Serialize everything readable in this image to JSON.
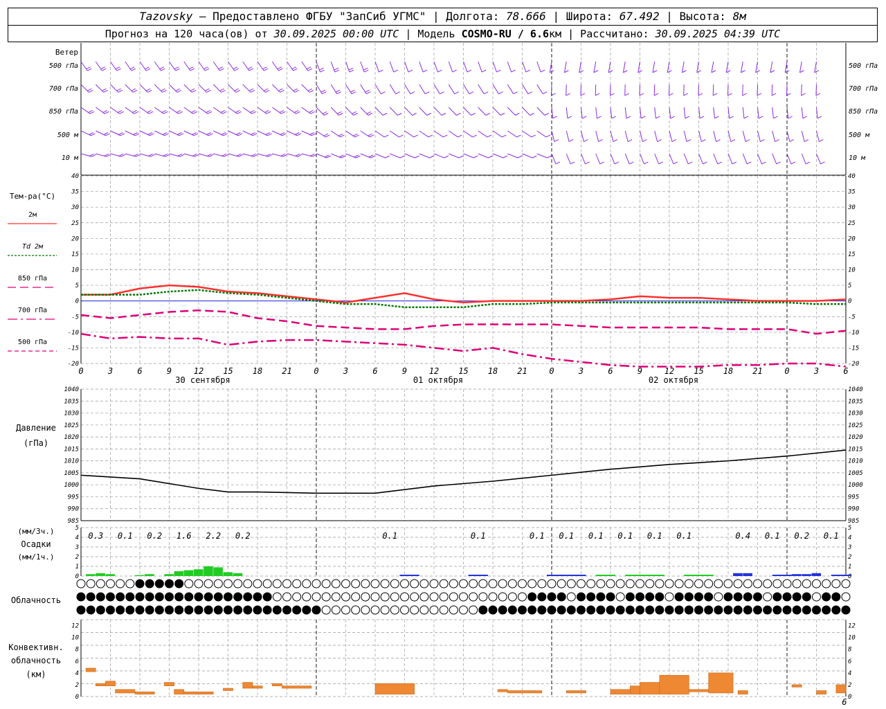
{
  "header": {
    "station": "Tazovsky",
    "provider": "— Предоставлено ФГБУ \"ЗапСиб УГМС\" |",
    "lon_label": "Долгота:",
    "lon": "78.666",
    "lat_label": "| Широта:",
    "lat": "67.492",
    "alt_label": "| Высота:",
    "alt": "8м",
    "forecast_label": "Прогноз на 120 часа(ов) от",
    "forecast_from": "30.09.2025 00:00 UTC",
    "model_label": "| Модель",
    "model": "COSMO-RU / 6.6",
    "model_unit": "км",
    "calc_label": "| Рассчитано:",
    "calc_time": "30.09.2025 04:39 UTC"
  },
  "time_axis": {
    "hour_ticks": [
      "0",
      "3",
      "6",
      "9",
      "12",
      "15",
      "18",
      "21",
      "0",
      "3",
      "6",
      "9",
      "12",
      "15",
      "18",
      "21",
      "0",
      "3",
      "6",
      "9",
      "12",
      "15",
      "18",
      "21",
      "0",
      "3",
      "6"
    ],
    "dates": [
      "30 сентября",
      "01 октября",
      "02 октября"
    ]
  },
  "wind_panel": {
    "labels": [
      "Ветер",
      "500 гПа",
      "700 гПа",
      "850 гПа",
      "500 м",
      "10  м"
    ],
    "right_labels": [
      "500 гПа",
      "700 гПа",
      "850 гПа",
      "500 м",
      "10  м"
    ],
    "color": "#8a2be2"
  },
  "cloud_panel": {
    "label": "Облачность"
  },
  "chart_data": [
    {
      "type": "line",
      "name": "temperature",
      "ylabel": "Тем-ра(°C)",
      "ylim": [
        -20,
        40
      ],
      "yticks": [
        "40",
        "35",
        "30",
        "25",
        "20",
        "15",
        "10",
        "5",
        "0",
        "-5",
        "-10",
        "-15",
        "-20"
      ],
      "x_hours": [
        0,
        3,
        6,
        9,
        12,
        15,
        18,
        21,
        24,
        27,
        30,
        33,
        36,
        39,
        42,
        45,
        48,
        51,
        54,
        57,
        60,
        63,
        66,
        69,
        72,
        75,
        78
      ],
      "series": [
        {
          "name": "2м",
          "color": "#ff3030",
          "style": "solid",
          "values": [
            2,
            2,
            4,
            5,
            4.5,
            3,
            2.5,
            1.5,
            0.5,
            -0.5,
            1,
            2.5,
            0.5,
            -0.5,
            0,
            0,
            0,
            0,
            0.5,
            1.5,
            1,
            1,
            0.5,
            0,
            0,
            0,
            0.5
          ]
        },
        {
          "name": "Td  2м",
          "color": "#007700",
          "style": "dotted",
          "values": [
            2,
            2,
            2,
            3,
            3.5,
            2.5,
            2,
            1,
            0,
            -1,
            -1,
            -2,
            -2,
            -2,
            -1,
            -1,
            -0.5,
            -0.5,
            -0.5,
            -0.5,
            -0.5,
            -0.5,
            -0.5,
            -0.5,
            -0.5,
            -1,
            -1
          ]
        },
        {
          "name": "850 гПа",
          "color": "#dd0077",
          "style": "dashed",
          "values": [
            -4.5,
            -5.5,
            -4.5,
            -3.5,
            -3,
            -3.5,
            -5.5,
            -6.5,
            -8,
            -8.5,
            -9,
            -9,
            -8,
            -7.5,
            -7.5,
            -7.5,
            -7.5,
            -8,
            -8.5,
            -8.5,
            -8.5,
            -8.5,
            -9,
            -9,
            -9,
            -10.5,
            -9.5
          ]
        },
        {
          "name": "700 гПа",
          "color": "#dd0077",
          "style": "dashdot",
          "values": [
            -10.5,
            -12,
            -11.5,
            -12,
            -12,
            -14,
            -13,
            -12.5,
            -12.5,
            -13,
            -13.5,
            -14,
            -15,
            -16,
            -15,
            -17,
            -18.5,
            -19.5,
            -20.5,
            -21,
            -21,
            -21,
            -20.5,
            -20.5,
            -20,
            -20,
            -21
          ]
        },
        {
          "name": "500 гПа",
          "color": "#dd0077",
          "style": "dash",
          "values": []
        }
      ],
      "baseline": 0
    },
    {
      "type": "line",
      "name": "pressure",
      "ylabel": "Давление",
      "unit": "(гПа)",
      "ylim": [
        985,
        1040
      ],
      "yticks": [
        "1040",
        "1035",
        "1030",
        "1025",
        "1020",
        "1015",
        "1010",
        "1005",
        "1000",
        "995",
        "990",
        "985"
      ],
      "x_hours": [
        0,
        6,
        12,
        15,
        18,
        24,
        30,
        36,
        42,
        48,
        54,
        60,
        66,
        72,
        78
      ],
      "values": [
        1004,
        1002.5,
        998.5,
        997,
        997,
        996.5,
        996.5,
        999.5,
        1001.5,
        1004,
        1006.5,
        1008.5,
        1010,
        1012,
        1014.5
      ]
    },
    {
      "type": "bar",
      "name": "precipitation",
      "ylabel": "Осадки",
      "unit3": "(мм/3ч.)",
      "unit1": "(мм/1ч.)",
      "ylim": [
        0,
        5
      ],
      "yticks": [
        "5",
        "4",
        "3",
        "2",
        "1",
        "0"
      ],
      "totals_3h": [
        {
          "hour": 1.5,
          "value": "0.3"
        },
        {
          "hour": 4.5,
          "value": "0.1"
        },
        {
          "hour": 7.5,
          "value": "0.2"
        },
        {
          "hour": 10.5,
          "value": "1.6"
        },
        {
          "hour": 13.5,
          "value": "2.2"
        },
        {
          "hour": 16.5,
          "value": "0.2"
        },
        {
          "hour": 31.5,
          "value": "0.1"
        },
        {
          "hour": 40.5,
          "value": "0.1"
        },
        {
          "hour": 46.5,
          "value": "0.1"
        },
        {
          "hour": 49.5,
          "value": "0.1"
        },
        {
          "hour": 52.5,
          "value": "0.1"
        },
        {
          "hour": 55.5,
          "value": "0.1"
        },
        {
          "hour": 58.5,
          "value": "0.1"
        },
        {
          "hour": 61.5,
          "value": "0.1"
        },
        {
          "hour": 67.5,
          "value": "0.4"
        },
        {
          "hour": 70.5,
          "value": "0.1"
        },
        {
          "hour": 73.5,
          "value": "0.2"
        },
        {
          "hour": 76.5,
          "value": "0.1"
        }
      ],
      "hourly_rain": [
        {
          "hour": 1,
          "value": 0.2
        },
        {
          "hour": 2,
          "value": 0.3
        },
        {
          "hour": 3,
          "value": 0.2
        },
        {
          "hour": 6,
          "value": 0.1
        },
        {
          "hour": 7,
          "value": 0.2
        },
        {
          "hour": 9,
          "value": 0.2
        },
        {
          "hour": 10,
          "value": 0.5
        },
        {
          "hour": 11,
          "value": 0.6
        },
        {
          "hour": 12,
          "value": 0.7
        },
        {
          "hour": 13,
          "value": 1.0
        },
        {
          "hour": 14,
          "value": 0.9
        },
        {
          "hour": 15,
          "value": 0.4
        },
        {
          "hour": 16,
          "value": 0.3
        }
      ],
      "hourly_snow": [
        {
          "hour": 67,
          "value": 0.3
        },
        {
          "hour": 68,
          "value": 0.3
        },
        {
          "hour": 73,
          "value": 0.2
        },
        {
          "hour": 74,
          "value": 0.2
        },
        {
          "hour": 75,
          "value": 0.3
        }
      ],
      "rain_color": "#22cc22",
      "snow_color": "#2233dd"
    },
    {
      "type": "bar",
      "name": "convective_clouds",
      "ylabel": "Конвективн.",
      "ylabel2": "облачность",
      "unit": "(км)",
      "ylim": [
        0,
        13
      ],
      "yticks": [
        "12",
        "10",
        "8",
        "6",
        "4",
        "2",
        "0"
      ],
      "color": "#ee8833",
      "bars": [
        {
          "from": 0.5,
          "to": 1.5,
          "top": 4.8,
          "bottom": 4.2
        },
        {
          "from": 1.5,
          "to": 2.5,
          "top": 2.2,
          "bottom": 1.8
        },
        {
          "from": 2.5,
          "to": 3.5,
          "top": 2.6,
          "bottom": 1.8
        },
        {
          "from": 3.5,
          "to": 5.5,
          "top": 1.2,
          "bottom": 0.6
        },
        {
          "from": 5.5,
          "to": 7.5,
          "top": 0.8,
          "bottom": 0.4
        },
        {
          "from": 8.5,
          "to": 9.5,
          "top": 2.4,
          "bottom": 1.8
        },
        {
          "from": 9.5,
          "to": 10.5,
          "top": 1.2,
          "bottom": 0.4
        },
        {
          "from": 10.5,
          "to": 13.5,
          "top": 0.8,
          "bottom": 0.4
        },
        {
          "from": 14.5,
          "to": 15.5,
          "top": 1.4,
          "bottom": 1.0
        },
        {
          "from": 16.5,
          "to": 17.5,
          "top": 2.4,
          "bottom": 1.4
        },
        {
          "from": 17.5,
          "to": 18.5,
          "top": 1.8,
          "bottom": 1.4
        },
        {
          "from": 19.5,
          "to": 20.5,
          "top": 2.2,
          "bottom": 1.8
        },
        {
          "from": 20.5,
          "to": 23.5,
          "top": 1.8,
          "bottom": 1.4
        },
        {
          "from": 30,
          "to": 34,
          "top": 2.2,
          "bottom": 0.4
        },
        {
          "from": 42.5,
          "to": 43.5,
          "top": 1.2,
          "bottom": 0.8
        },
        {
          "from": 43.5,
          "to": 47,
          "top": 1.0,
          "bottom": 0.6
        },
        {
          "from": 49.5,
          "to": 51.5,
          "top": 1.0,
          "bottom": 0.6
        },
        {
          "from": 54,
          "to": 56,
          "top": 1.2,
          "bottom": 0.4
        },
        {
          "from": 56,
          "to": 57,
          "top": 1.8,
          "bottom": 0.4
        },
        {
          "from": 57,
          "to": 59,
          "top": 2.4,
          "bottom": 0.4
        },
        {
          "from": 59,
          "to": 62,
          "top": 3.6,
          "bottom": 0.4
        },
        {
          "from": 62,
          "to": 64,
          "top": 1.2,
          "bottom": 0.8
        },
        {
          "from": 64,
          "to": 66.5,
          "top": 4.0,
          "bottom": 0.6
        },
        {
          "from": 67,
          "to": 68,
          "top": 1.0,
          "bottom": 0.4
        },
        {
          "from": 72.5,
          "to": 73.5,
          "top": 2.0,
          "bottom": 1.6
        },
        {
          "from": 75,
          "to": 76,
          "top": 1.0,
          "bottom": 0.4
        },
        {
          "from": 77,
          "to": 78,
          "top": 2.0,
          "bottom": 0.6
        }
      ]
    }
  ]
}
